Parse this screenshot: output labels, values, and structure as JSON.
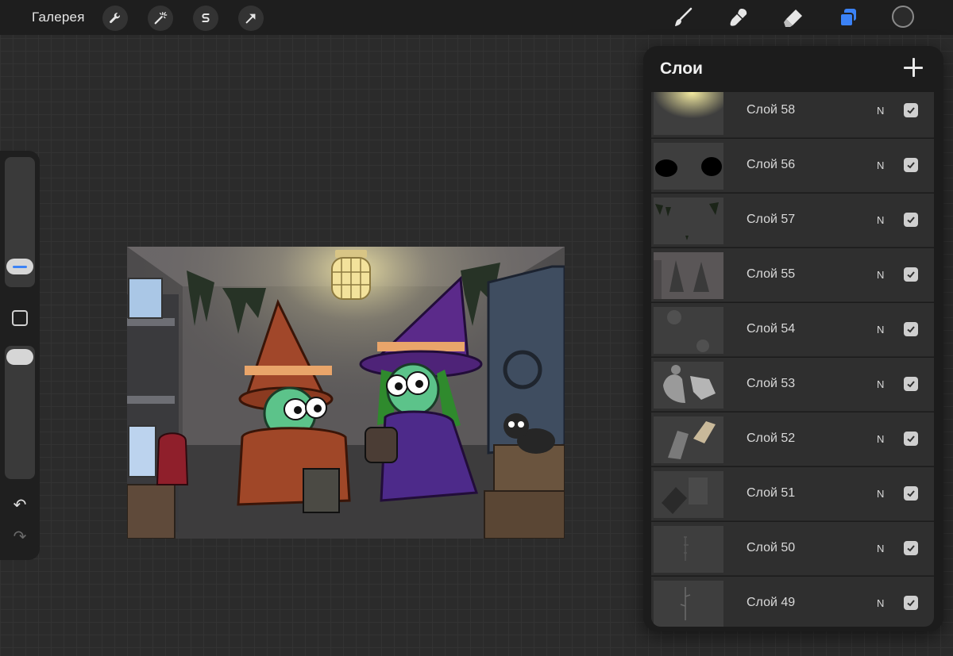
{
  "toolbar": {
    "gallery_label": "Галерея",
    "left_tools": [
      "wrench-icon",
      "magic-wand-icon",
      "selection-s-icon",
      "arrow-icon"
    ],
    "right_tools": [
      "brush-icon",
      "smudge-icon",
      "eraser-icon",
      "layers-icon"
    ],
    "active_tool": "layers-icon",
    "accent_color": "#3b82f6",
    "current_color": "#2b2b2b"
  },
  "sidebar": {
    "brush_size_level": 0.85,
    "opacity_level": 0.0
  },
  "layers_panel": {
    "title": "Слои",
    "add_icon": "plus-icon",
    "layers": [
      {
        "name": "Слой 58",
        "mode": "N",
        "visible": true
      },
      {
        "name": "Слой 56",
        "mode": "N",
        "visible": true
      },
      {
        "name": "Слой 57",
        "mode": "N",
        "visible": true
      },
      {
        "name": "Слой 55",
        "mode": "N",
        "visible": true
      },
      {
        "name": "Слой 54",
        "mode": "N",
        "visible": true
      },
      {
        "name": "Слой 53",
        "mode": "N",
        "visible": true
      },
      {
        "name": "Слой 52",
        "mode": "N",
        "visible": true
      },
      {
        "name": "Слой 51",
        "mode": "N",
        "visible": true
      },
      {
        "name": "Слой 50",
        "mode": "N",
        "visible": true
      },
      {
        "name": "Слой 49",
        "mode": "N",
        "visible": true
      }
    ]
  }
}
